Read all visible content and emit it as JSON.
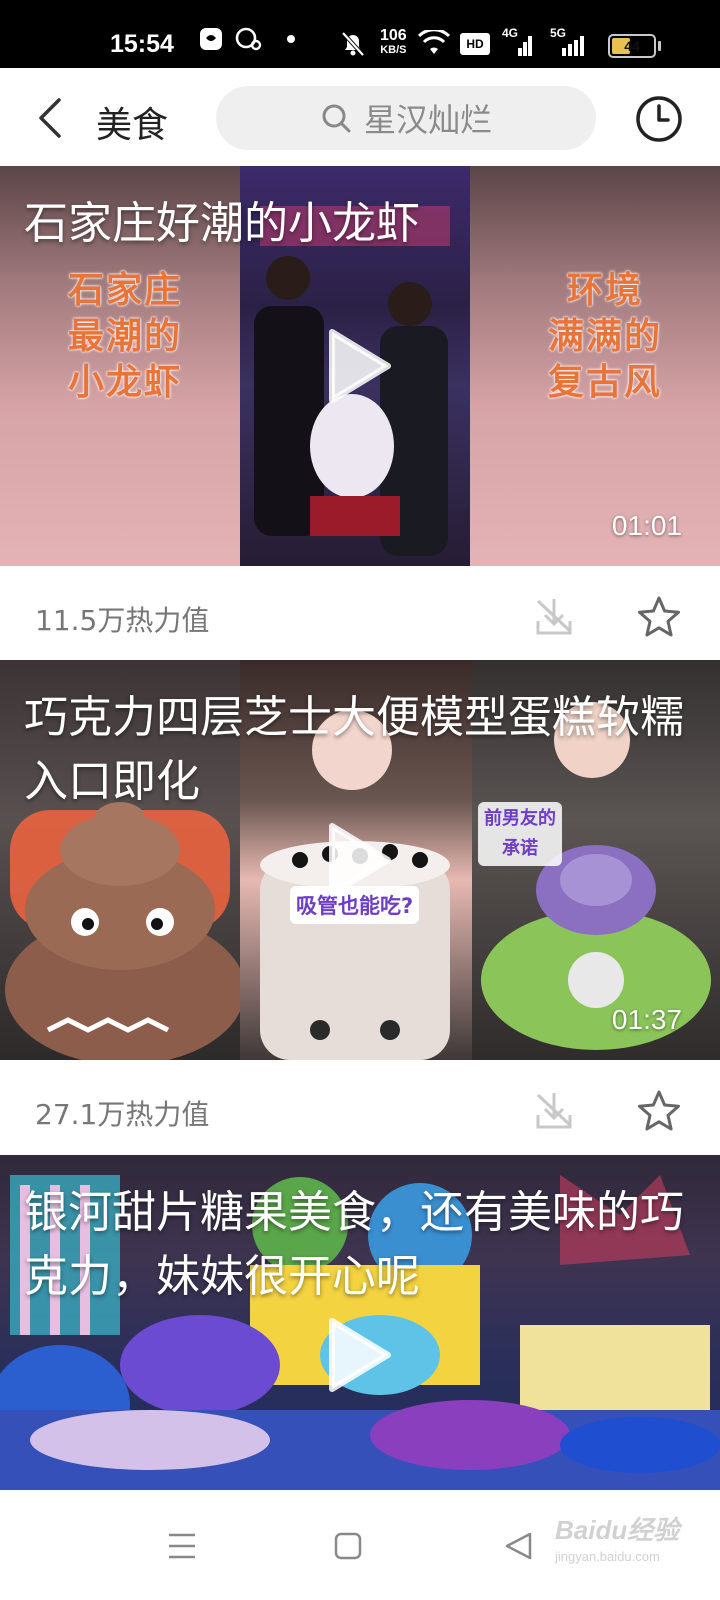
{
  "status_bar": {
    "time": "15:54",
    "net_speed_value": "106",
    "net_speed_unit": "KB/S",
    "hd_label": "HD",
    "sig1_label": "4G",
    "sig2_label": "5G",
    "battery_level": "44",
    "battery_fraction": 0.44,
    "battery_color": "#e8c250"
  },
  "header": {
    "back_icon": "chevron-left-icon",
    "title": "美食",
    "search_placeholder": "星汉灿烂",
    "history_icon": "clock-icon"
  },
  "feed": [
    {
      "title": "石家庄好潮的小龙虾",
      "duration": "01:01",
      "heat": "11.5万热力值",
      "left_caption": "石家庄\n最潮的\n小龙虾",
      "right_caption": "环境\n满满的\n复古风"
    },
    {
      "title": "巧克力四层芝士大便模型蛋糕软糯入口即化",
      "duration": "01:37",
      "heat": "27.1万热力值",
      "middle_caption": "吸管也能吃?",
      "right_caption": "前男友的\n承诺"
    },
    {
      "title": "银河甜片糖果美食，还有美味的巧克力，妹妹很开心呢"
    }
  ],
  "nav": {
    "menu_icon": "menu-icon",
    "home_icon": "home-square-icon",
    "back_icon": "triangle-back-icon"
  },
  "watermark": {
    "logo": "Baidu经验",
    "sub": "jingyan.baidu.com"
  }
}
